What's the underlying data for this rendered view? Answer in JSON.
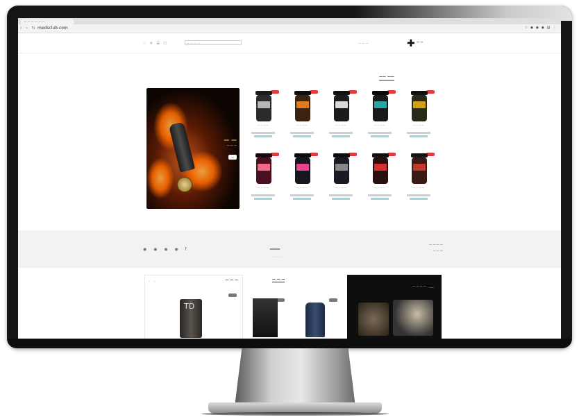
{
  "browser": {
    "tab_title": "— — — — — —",
    "url": "medsclub.com",
    "nav_glyphs": "‹ › ↻",
    "extension_glyphs": "☆ ◉ ◉ ◉ ▤ ⋮"
  },
  "header": {
    "icons": "♡ ⚲ ☰ ☐",
    "search_placeholder": "— — — —",
    "menu_text": "— — —",
    "logo_cross": "✚",
    "logo_text": "— —"
  },
  "section_title": "—— ——",
  "banner": {
    "title": "— —",
    "subtitle": "— — —",
    "button_label": "—"
  },
  "products": [
    {
      "name": "— — — —",
      "color_body": "#2a2a1a",
      "color_lid": "#111111",
      "color_label": "#d4a017"
    },
    {
      "name": "— — — —",
      "color_body": "#1a1a1a",
      "color_lid": "#0a0a0a",
      "color_label": "#2aa6a6"
    },
    {
      "name": "— — — —",
      "color_body": "#1b1b1b",
      "color_lid": "#111111",
      "color_label": "#d9d9d9"
    },
    {
      "name": "— — — —",
      "color_body": "#3a2410",
      "color_lid": "#0e0e0e",
      "color_label": "#e07a1f"
    },
    {
      "name": "— — — —",
      "color_body": "#2b2b2b",
      "color_lid": "#1a1a1a",
      "color_label": "#b8b8b8"
    },
    {
      "name": "— — — —",
      "color_body": "#3a1a14",
      "color_lid": "#141414",
      "color_label": "#c0392b"
    },
    {
      "name": "— — — —",
      "color_body": "#2a0f0f",
      "color_lid": "#111111",
      "color_label": "#d63031"
    },
    {
      "name": "— — — —",
      "color_body": "#1a1a22",
      "color_lid": "#0c0c0c",
      "color_label": "#888888"
    },
    {
      "name": "— — — —",
      "color_body": "#16161f",
      "color_lid": "#0a0a0a",
      "color_label": "#e84393"
    },
    {
      "name": "— — — —",
      "color_body": "#4a1020",
      "color_lid": "#1a0610",
      "color_label": "#f06a8a"
    }
  ],
  "brand_strip": {
    "social": "◉ ◉ ◉ ◉ f",
    "logo": "—",
    "tagline": "— — —",
    "contact_line1": "— — — —",
    "contact_line2": "— — —"
  },
  "lower": {
    "left_title": "— — —",
    "left_dots": "‹ ›",
    "left_product_mark": "TD",
    "mid_title": "— — —",
    "right_title": "— — — —",
    "right_logo": "—"
  }
}
